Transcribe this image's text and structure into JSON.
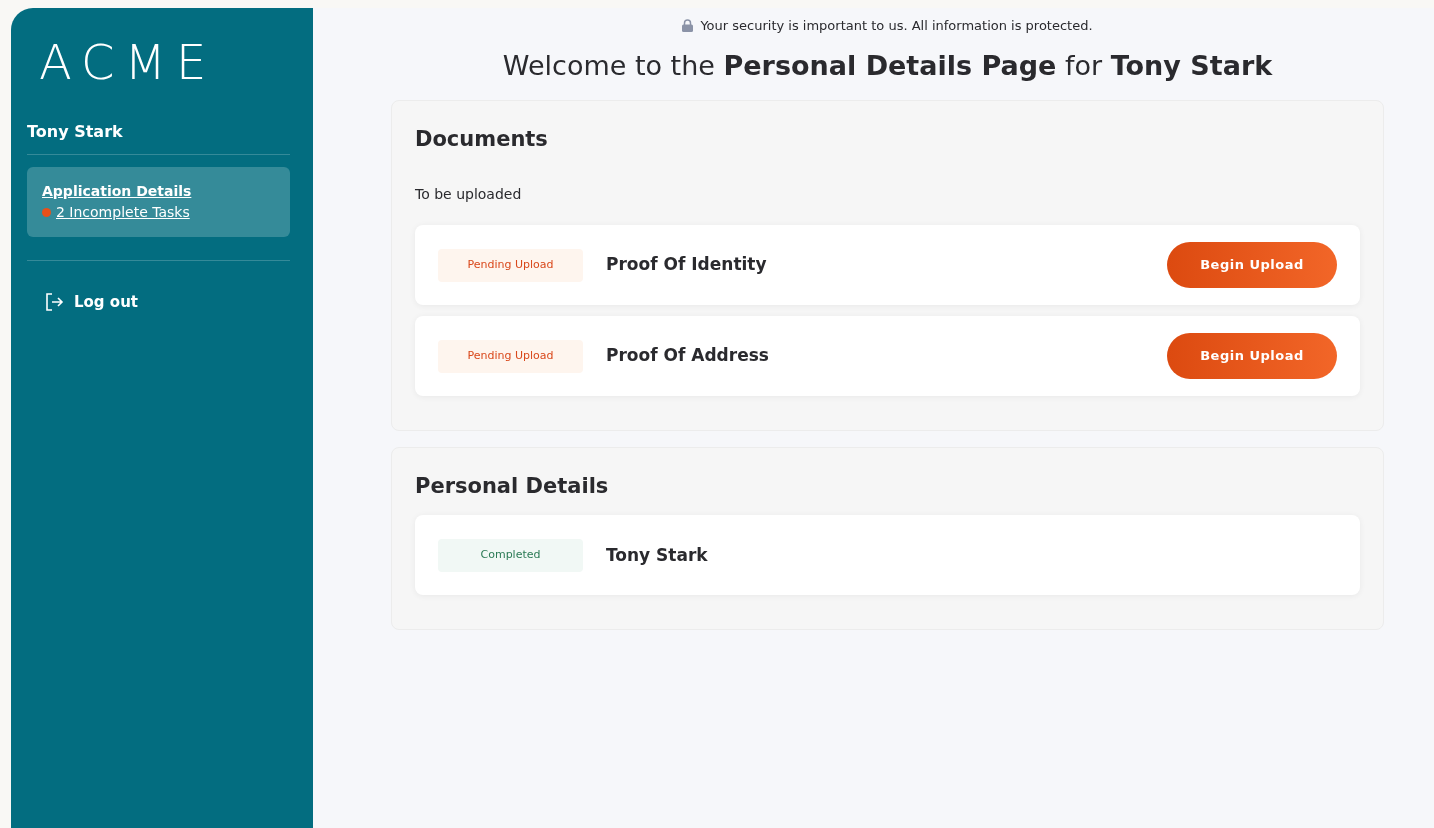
{
  "sidebar": {
    "logo": "ACME",
    "user_name": "Tony Stark",
    "items": [
      {
        "title": "Application Details",
        "subtitle": "2 Incomplete Tasks",
        "color": "#e8501a",
        "selected": true
      }
    ],
    "logout": "Log out"
  },
  "security_note": "Your security is important to us. All information is protected.",
  "heading": "Welcome to the **Personal Details Page** for **Tony Stark**",
  "sections": [
    {
      "title": "Documents",
      "subtitle": "To be uploaded",
      "rows": [
        {
          "status": "Pending Upload",
          "kind": "pending",
          "label": "Proof Of Identity",
          "button": "Begin Upload"
        },
        {
          "status": "Pending Upload",
          "kind": "pending",
          "label": "Proof Of Address",
          "button": "Begin Upload"
        }
      ]
    },
    {
      "title": "Personal Details",
      "rows": [
        {
          "status": "Completed",
          "kind": "completed",
          "label": "Tony Stark"
        }
      ]
    }
  ]
}
